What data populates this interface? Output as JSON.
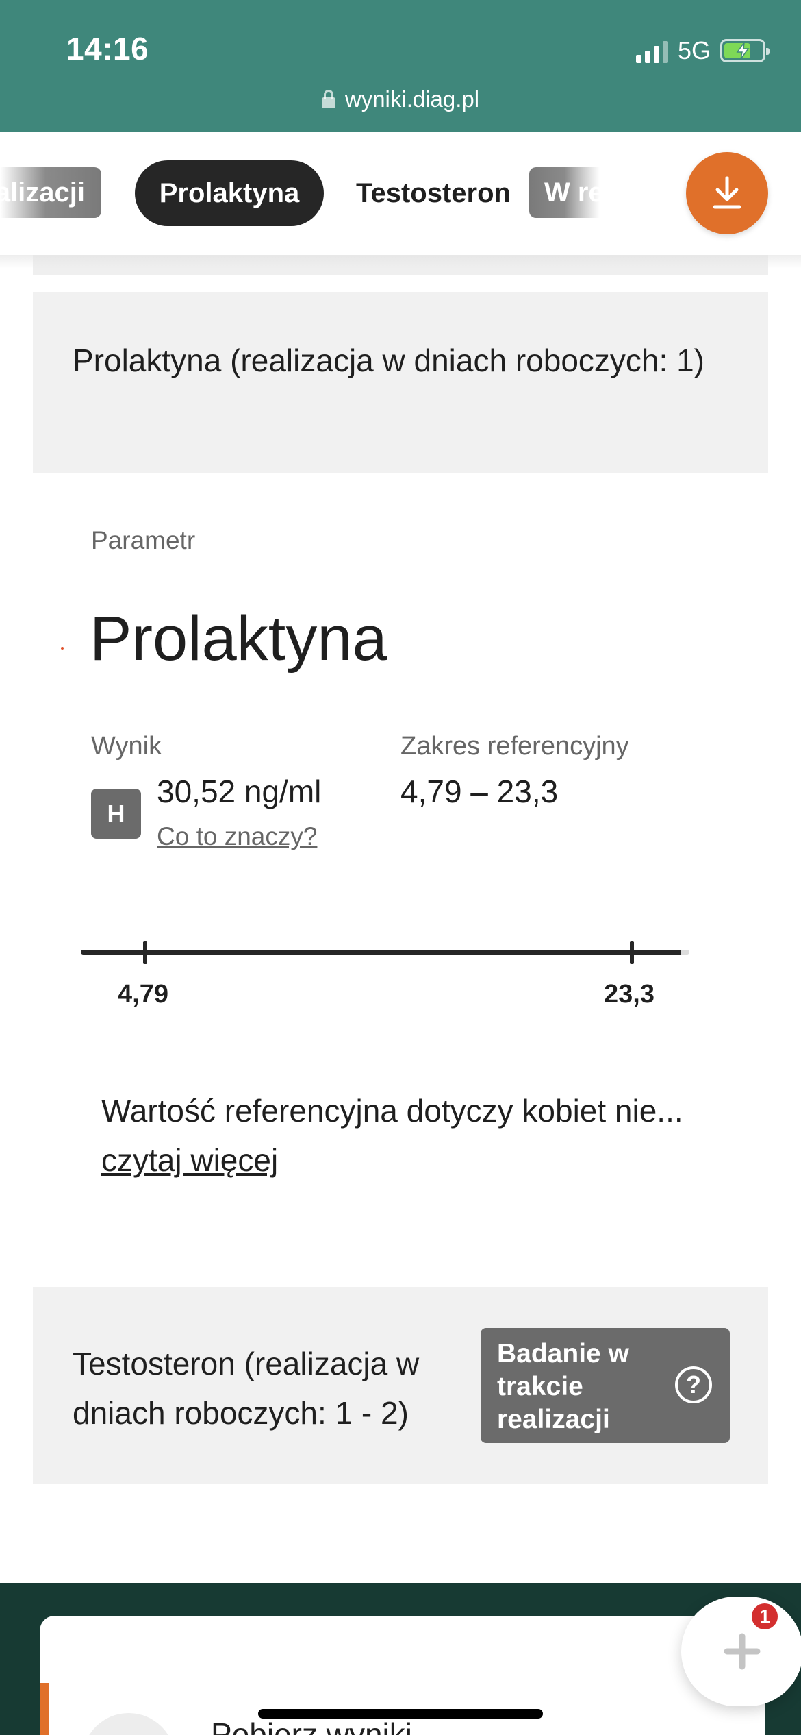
{
  "status_bar": {
    "time": "14:16",
    "network": "5G"
  },
  "browser": {
    "url": "wyniki.diag.pl"
  },
  "tabs": {
    "prev_partial": "alizacji",
    "active": "Prolaktyna",
    "next": "Testosteron",
    "next_partial": "W re"
  },
  "section_prolaktyna": {
    "header": "Prolaktyna (realizacja w dniach roboczych: 1)",
    "parameter_label": "Parametr",
    "parameter_name": "Prolaktyna",
    "result_label": "Wynik",
    "reference_label": "Zakres referencyjny",
    "flag": "H",
    "result_value": "30,52 ng/ml",
    "result_link": "Co to znaczy?",
    "reference_value": "4,79 – 23,3",
    "range_min_label": "4,79",
    "range_max_label": "23,3",
    "note": "Wartość referencyjna dotyczy kobiet nie...",
    "note_link": "czytaj więcej"
  },
  "section_testosteron": {
    "header": "Testosteron (realizacja w dniach roboczych: 1 - 2)",
    "status_button": "Badanie w trakcie realizacji",
    "help_icon_glyph": "?"
  },
  "bottom": {
    "card_title": "Pobierz wyniki",
    "fab_badge": "1"
  },
  "colors": {
    "header_green": "#3f877b",
    "accent_orange": "#e0702a",
    "dark_green": "#173a33",
    "flag_gray": "#6b6b6b"
  }
}
